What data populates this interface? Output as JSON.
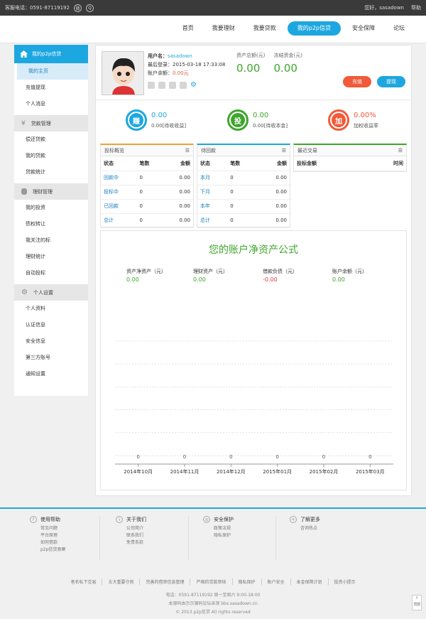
{
  "topbar": {
    "hotline": "客服电话：0591-87119192",
    "greeting": "您好，sasadown",
    "help": "帮助"
  },
  "nav": {
    "items": [
      "首页",
      "我要理财",
      "我要贷款",
      "我的p2p信贷",
      "安全保障",
      "论坛"
    ],
    "active_index": 3
  },
  "sidebar": {
    "header": "我的p2p信贷",
    "main_items": [
      "我的主页",
      "充值提现",
      "个人消息"
    ],
    "groups": [
      {
        "title": "贷款管理",
        "items": [
          "偿还贷款",
          "我的贷款",
          "贷款统计"
        ]
      },
      {
        "title": "理财管理",
        "items": [
          "我的投资",
          "债权转让",
          "我关注的标",
          "理财统计",
          "自动投标"
        ]
      },
      {
        "title": "个人设置",
        "items": [
          "个人资料",
          "认证信息",
          "安全信息",
          "第三方账号",
          "通知设置"
        ]
      }
    ]
  },
  "user": {
    "name_label": "用户名：",
    "name": "sasadown",
    "last_login_label": "最后登录：",
    "last_login": "2015-03-18 17:33:08",
    "balance_label": "账户余额：",
    "balance": "0.00元"
  },
  "assets": {
    "total_label": "资产总额(元)",
    "total": "0.00",
    "frozen_label": "冻结资金(元)",
    "frozen": "0.00"
  },
  "buttons": {
    "recharge": "充值",
    "withdraw": "提现"
  },
  "stats": [
    {
      "icon": "赚",
      "value": "0.00",
      "label": "0.00[待收收益]",
      "color": "#1da7e0"
    },
    {
      "icon": "投",
      "value": "0.00",
      "label": "0.00[待收本金]",
      "color": "#3fa52c"
    },
    {
      "icon": "加",
      "value": "0.00%",
      "label": "加权收益率",
      "color": "#f15a3a"
    }
  ],
  "panels": {
    "invest": {
      "title": "投标概览",
      "headers": [
        "状态",
        "笔数",
        "金额"
      ],
      "rows": [
        [
          "回款中",
          "0",
          "0.00"
        ],
        [
          "投标中",
          "0",
          "0.00"
        ],
        [
          "已回款",
          "0",
          "0.00"
        ],
        [
          "总计",
          "0",
          "0.00"
        ]
      ]
    },
    "repay": {
      "title": "待回款",
      "headers": [
        "状态",
        "笔数",
        "金额"
      ],
      "rows": [
        [
          "本月",
          "0",
          "0.00"
        ],
        [
          "下月",
          "0",
          "0.00"
        ],
        [
          "本年",
          "0",
          "0.00"
        ],
        [
          "总计",
          "0",
          "0.00"
        ]
      ]
    },
    "recent": {
      "title": "最近交易",
      "headers": [
        "投标金额",
        "时间"
      ]
    }
  },
  "formula": {
    "title": "您的账户净资产公式",
    "items": [
      {
        "label": "资产净资产（元）",
        "value": "0.00"
      },
      {
        "label": "理财资产（元）",
        "value": "0.00"
      },
      {
        "label": "借款负债（元）",
        "value": "-0.00"
      },
      {
        "label": "账户余额（元）",
        "value": "0.00"
      }
    ]
  },
  "chart_data": {
    "type": "bar",
    "categories": [
      "2014年10月",
      "2014年11月",
      "2014年12月",
      "2015年01月",
      "2015年02月",
      "2015年03月"
    ],
    "values": [
      0,
      0,
      0,
      0,
      0,
      0
    ],
    "title": "",
    "xlabel": "",
    "ylabel": "",
    "grid": true
  },
  "footer": {
    "cols": [
      {
        "title": "使用帮助",
        "icon": "?",
        "links": [
          "常见问题",
          "平台原理",
          "如何借款",
          "p2p信贷奥寒"
        ]
      },
      {
        "title": "关于我们",
        "icon": "i",
        "links": [
          "公司简介",
          "联系我们",
          "免责条款"
        ]
      },
      {
        "title": "安全保护",
        "icon": "◎",
        "links": [
          "政策法规",
          "隐私保护"
        ]
      },
      {
        "title": "了解更多",
        "icon": "+",
        "links": [
          "咨询热点"
        ]
      }
    ],
    "links": [
      "者名私下交易",
      "五大重要守则",
      "完善的借审信息管理",
      "严格的贷款审核",
      "隐私保护",
      "账户安全",
      "本金保障计划",
      "投资小提示"
    ],
    "phone": "电话：0591-87119192 周一至周六 9:00-18:00",
    "source": "本源码由示示源码论坛亲测 bbs.sasadown.cn",
    "copyright": "© 2013 p2p信贷 All rights reserved",
    "totop": "顶部"
  }
}
